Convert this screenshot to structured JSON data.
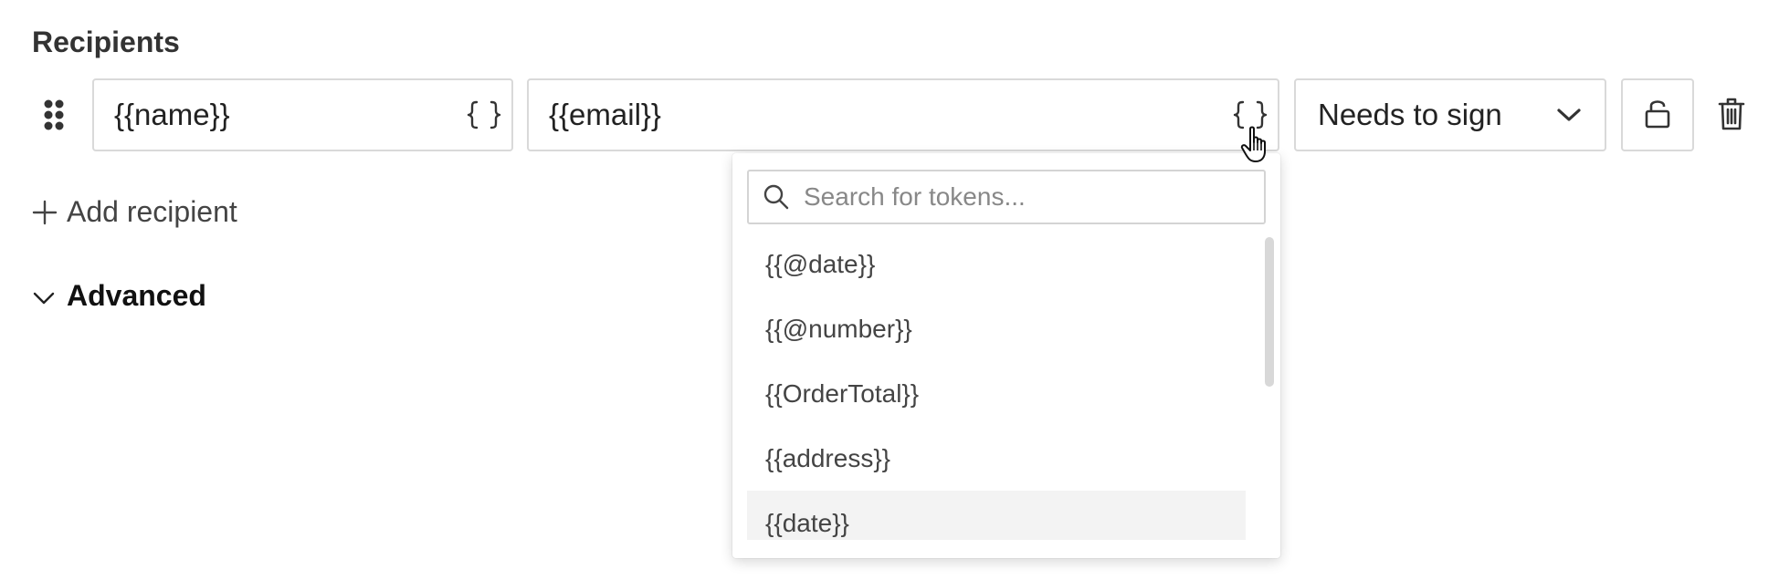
{
  "recipients": {
    "title": "Recipients",
    "row": {
      "name_value": "{{name}}",
      "email_value": "{{email}}",
      "role_value": "Needs to sign"
    },
    "add_label": "Add recipient",
    "advanced_label": "Advanced"
  },
  "token_dropdown": {
    "search_placeholder": "Search for tokens...",
    "items": [
      "{{@date}}",
      "{{@number}}",
      "{{OrderTotal}}",
      "{{address}}",
      "{{date}}"
    ],
    "hovered_index": 4
  },
  "icons": {
    "drag": "drag-handle-icon",
    "token": "braces-icon",
    "role_chevron": "chevron-down-icon",
    "lock": "unlock-icon",
    "delete": "trash-icon",
    "add": "plus-icon",
    "advanced": "chevron-down-icon",
    "search": "search-icon",
    "cursor": "hand-pointer-cursor"
  },
  "colors": {
    "border": "#d9d9d9",
    "text": "#222222",
    "muted": "#888888",
    "hover_bg": "#f3f3f3"
  }
}
